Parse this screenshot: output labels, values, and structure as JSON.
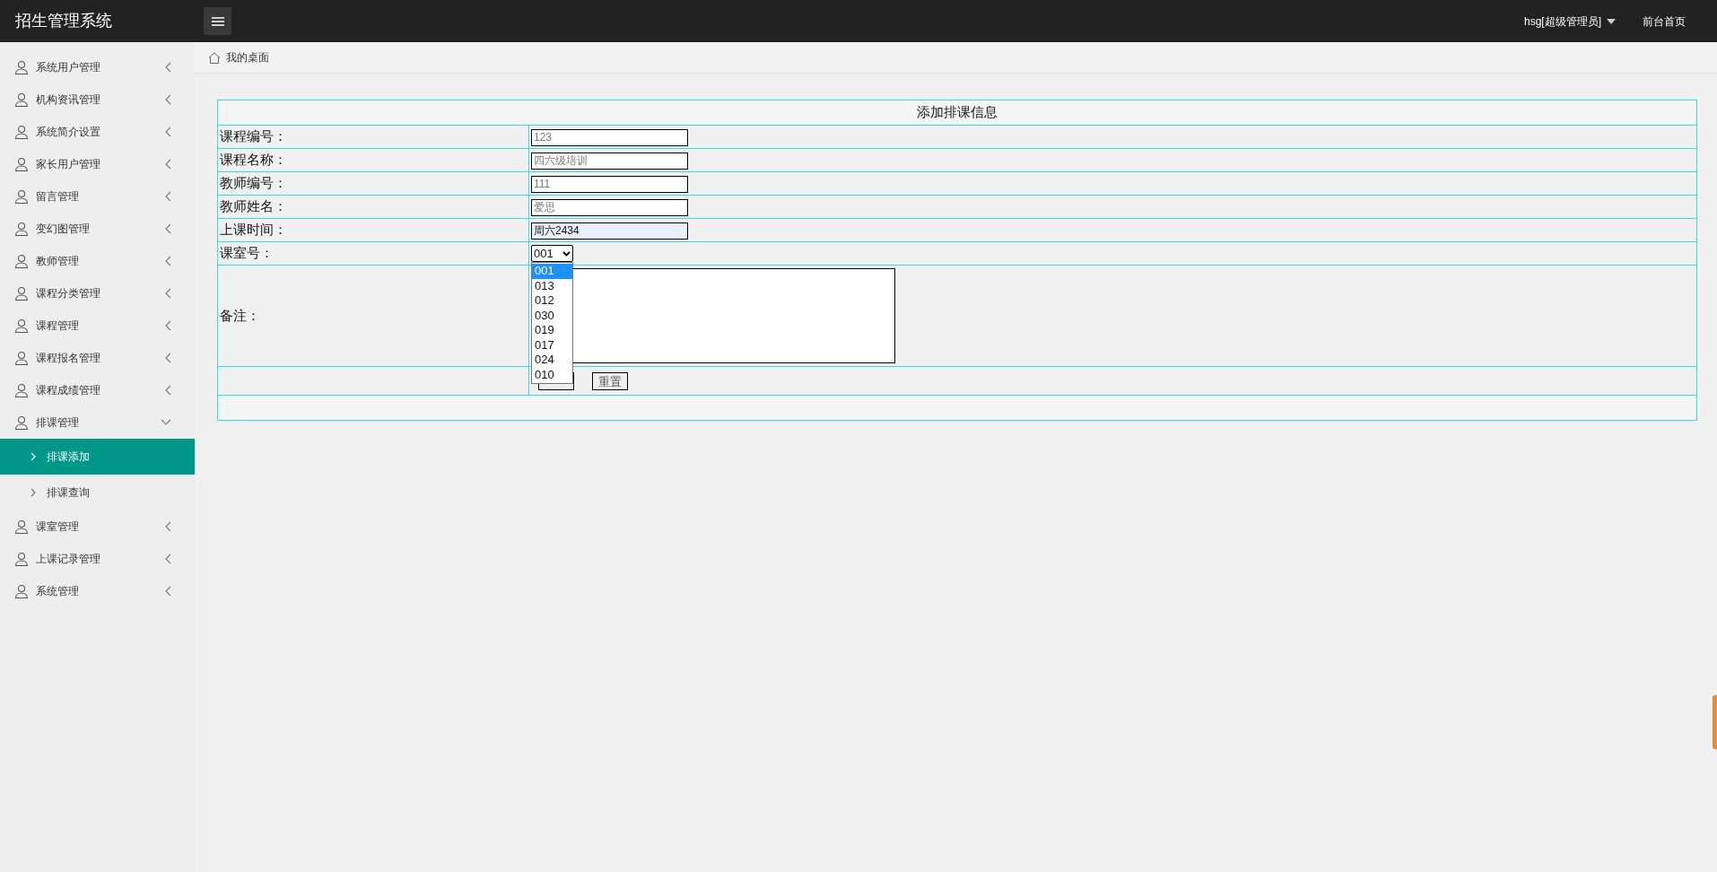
{
  "header": {
    "title": "招生管理系统",
    "user": "hsg[超级管理员]",
    "home_link": "前台首页"
  },
  "sidebar": {
    "items": [
      {
        "label": "系统用户管理",
        "expanded": false
      },
      {
        "label": "机构资讯管理",
        "expanded": false
      },
      {
        "label": "系统简介设置",
        "expanded": false
      },
      {
        "label": "家长用户管理",
        "expanded": false
      },
      {
        "label": "留言管理",
        "expanded": false
      },
      {
        "label": "变幻图管理",
        "expanded": false
      },
      {
        "label": "教师管理",
        "expanded": false
      },
      {
        "label": "课程分类管理",
        "expanded": false
      },
      {
        "label": "课程管理",
        "expanded": false
      },
      {
        "label": "课程报名管理",
        "expanded": false
      },
      {
        "label": "课程成绩管理",
        "expanded": false
      },
      {
        "label": "排课管理",
        "expanded": true,
        "children": [
          {
            "label": "排课添加",
            "selected": true
          },
          {
            "label": "排课查询",
            "selected": false
          }
        ]
      },
      {
        "label": "课室管理",
        "expanded": false
      },
      {
        "label": "上课记录管理",
        "expanded": false
      },
      {
        "label": "系统管理",
        "expanded": false
      }
    ]
  },
  "breadcrumb": "我的桌面",
  "form": {
    "title": "添加排课信息",
    "fields": [
      {
        "kind": "text",
        "label": "课程编号：",
        "value": "123",
        "disabled": true
      },
      {
        "kind": "text",
        "label": "课程名称：",
        "value": "四六级培训",
        "disabled": true
      },
      {
        "kind": "text",
        "label": "教师编号：",
        "value": "111",
        "disabled": true
      },
      {
        "kind": "text",
        "label": "教师姓名：",
        "value": "爱思",
        "disabled": true
      },
      {
        "kind": "text",
        "label": "上课时间：",
        "value": "周六2434",
        "disabled": false
      },
      {
        "kind": "select",
        "label": "课室号：",
        "value": "001",
        "expanded": true,
        "options": [
          {
            "label": "001",
            "selected": true
          },
          {
            "label": "013",
            "selected": false
          },
          {
            "label": "012",
            "selected": false
          },
          {
            "label": "030",
            "selected": false
          },
          {
            "label": "019",
            "selected": false
          },
          {
            "label": "017",
            "selected": false
          },
          {
            "label": "024",
            "selected": false
          },
          {
            "label": "010",
            "selected": false
          }
        ]
      },
      {
        "kind": "textarea",
        "label": "备注："
      }
    ],
    "buttons": [
      "重置"
    ]
  }
}
